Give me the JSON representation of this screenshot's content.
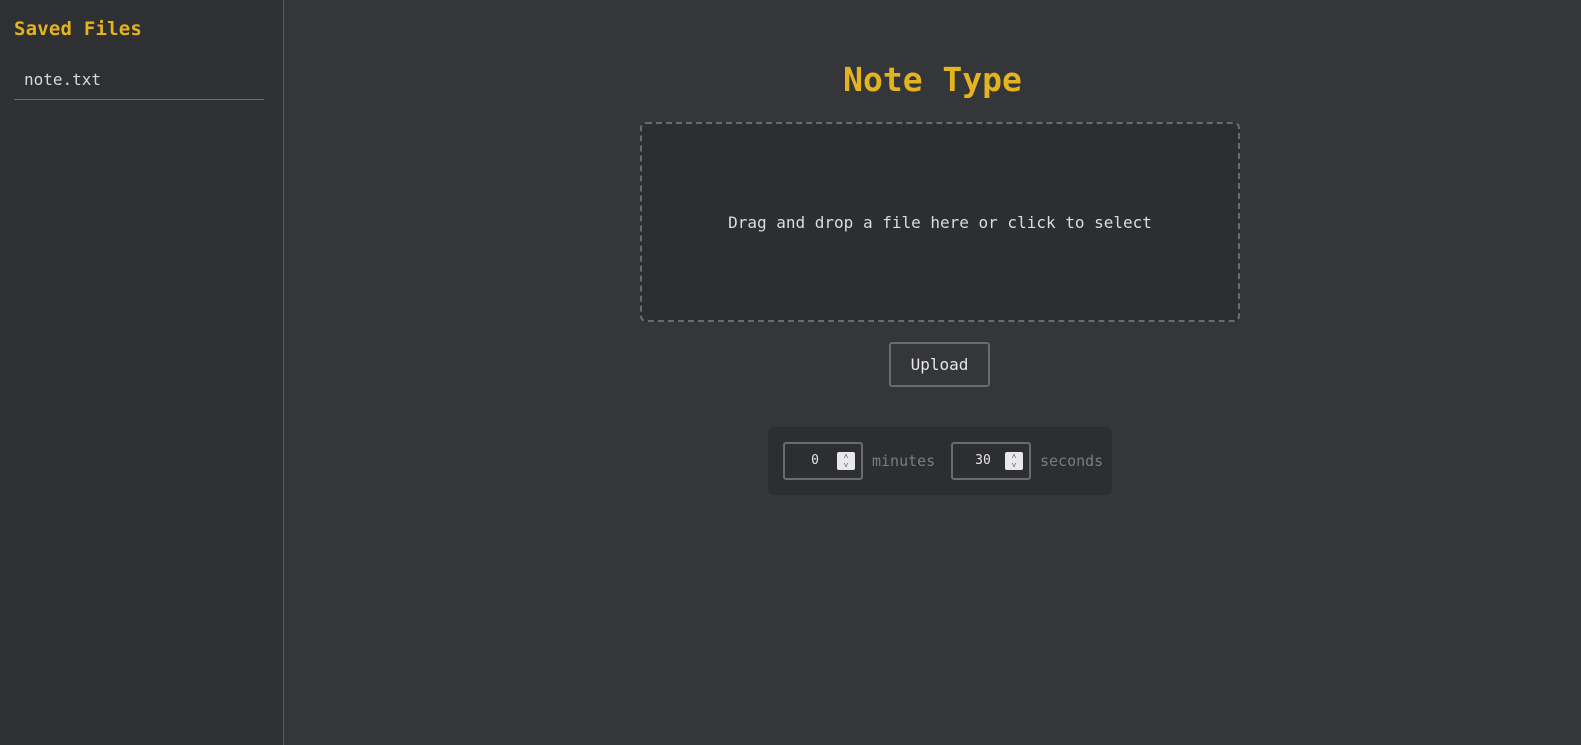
{
  "sidebar": {
    "title": "Saved Files",
    "files": [
      {
        "name": "note.txt"
      }
    ]
  },
  "main": {
    "title": "Note Type",
    "dropzone_text": "Drag and drop a file here or click to select",
    "upload_label": "Upload",
    "timer": {
      "minutes_value": "0",
      "minutes_label": "minutes",
      "seconds_value": "30",
      "seconds_label": "seconds"
    }
  },
  "colors": {
    "accent": "#e4b41f",
    "background": "#35363a",
    "sidebar_background": "#2f3034"
  },
  "icons": {
    "spinner_up": "chevron-up-icon",
    "spinner_down": "chevron-down-icon"
  }
}
